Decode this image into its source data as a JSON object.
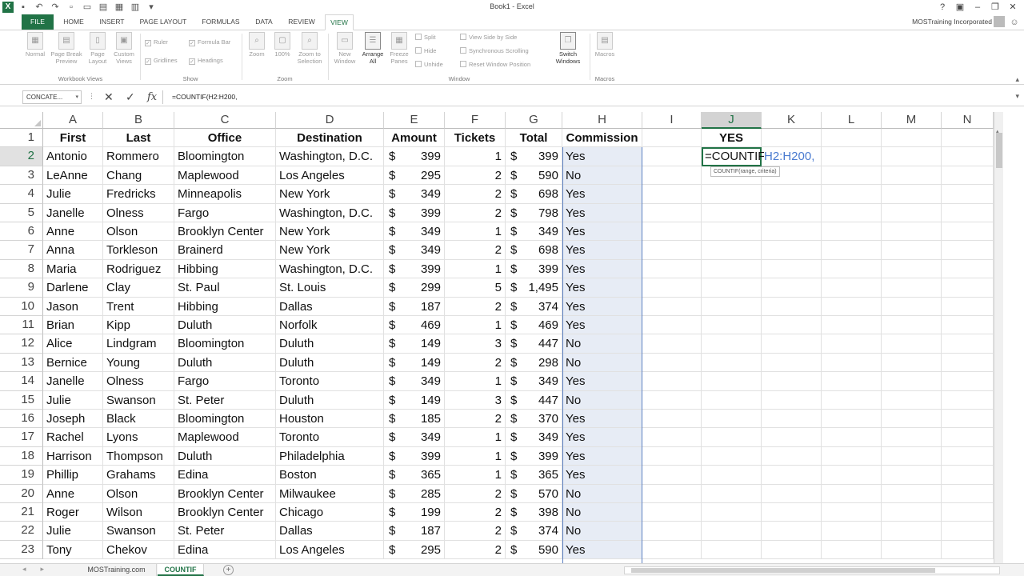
{
  "window": {
    "title": "Book1 - Excel",
    "account": "MOSTraining Incorporated",
    "logo": "X"
  },
  "tabs": [
    "FILE",
    "HOME",
    "INSERT",
    "PAGE LAYOUT",
    "FORMULAS",
    "DATA",
    "REVIEW",
    "VIEW"
  ],
  "active_tab": "VIEW",
  "ribbon": {
    "workbook_views": {
      "label": "Workbook Views",
      "buttons": [
        "Normal",
        "Page Break Preview",
        "Page Layout",
        "Custom Views"
      ]
    },
    "show": {
      "label": "Show",
      "checks": [
        "Ruler",
        "Formula Bar",
        "Gridlines",
        "Headings"
      ]
    },
    "zoom": {
      "label": "Zoom",
      "buttons": [
        "Zoom",
        "100%",
        "Zoom to Selection"
      ]
    },
    "window": {
      "label": "Window",
      "buttons": [
        "New Window",
        "Arrange All",
        "Freeze Panes"
      ],
      "small": [
        "Split",
        "Hide",
        "Unhide"
      ],
      "side": [
        "View Side by Side",
        "Synchronous Scrolling",
        "Reset Window Position"
      ],
      "switch": "Switch Windows"
    },
    "macros": {
      "label": "Macros",
      "button": "Macros"
    }
  },
  "formula_bar": {
    "name_box": "CONCATE...",
    "formula": "=COUNTIF(H2:H200,"
  },
  "columns": [
    "A",
    "B",
    "C",
    "D",
    "E",
    "F",
    "G",
    "H",
    "I",
    "J",
    "K",
    "L",
    "M",
    "N"
  ],
  "selected_column": "J",
  "headers": [
    "First",
    "Last",
    "Office",
    "Destination",
    "Amount",
    "Tickets",
    "Total",
    "Commission"
  ],
  "j1": "YES",
  "edit": {
    "fn": "=COUNTIF(",
    "ref": "H2:H200,",
    "tooltip": "COUNTIF(range, criteria)"
  },
  "currency": "$",
  "rows": [
    [
      "Antonio",
      "Rommero",
      "Bloomington",
      "Washington, D.C.",
      "399",
      "1",
      "399",
      "Yes"
    ],
    [
      "LeAnne",
      "Chang",
      "Maplewood",
      "Los Angeles",
      "295",
      "2",
      "590",
      "No"
    ],
    [
      "Julie",
      "Fredricks",
      "Minneapolis",
      "New York",
      "349",
      "2",
      "698",
      "Yes"
    ],
    [
      "Janelle",
      "Olness",
      "Fargo",
      "Washington, D.C.",
      "399",
      "2",
      "798",
      "Yes"
    ],
    [
      "Anne",
      "Olson",
      "Brooklyn Center",
      "New York",
      "349",
      "1",
      "349",
      "Yes"
    ],
    [
      "Anna",
      "Torkleson",
      "Brainerd",
      "New York",
      "349",
      "2",
      "698",
      "Yes"
    ],
    [
      "Maria",
      "Rodriguez",
      "Hibbing",
      "Washington, D.C.",
      "399",
      "1",
      "399",
      "Yes"
    ],
    [
      "Darlene",
      "Clay",
      "St. Paul",
      "St. Louis",
      "299",
      "5",
      "1,495",
      "Yes"
    ],
    [
      "Jason",
      "Trent",
      "Hibbing",
      "Dallas",
      "187",
      "2",
      "374",
      "Yes"
    ],
    [
      "Brian",
      "Kipp",
      "Duluth",
      "Norfolk",
      "469",
      "1",
      "469",
      "Yes"
    ],
    [
      "Alice",
      "Lindgram",
      "Bloomington",
      "Duluth",
      "149",
      "3",
      "447",
      "No"
    ],
    [
      "Bernice",
      "Young",
      "Duluth",
      "Duluth",
      "149",
      "2",
      "298",
      "No"
    ],
    [
      "Janelle",
      "Olness",
      "Fargo",
      "Toronto",
      "349",
      "1",
      "349",
      "Yes"
    ],
    [
      "Julie",
      "Swanson",
      "St. Peter",
      "Duluth",
      "149",
      "3",
      "447",
      "No"
    ],
    [
      "Joseph",
      "Black",
      "Bloomington",
      "Houston",
      "185",
      "2",
      "370",
      "Yes"
    ],
    [
      "Rachel",
      "Lyons",
      "Maplewood",
      "Toronto",
      "349",
      "1",
      "349",
      "Yes"
    ],
    [
      "Harrison",
      "Thompson",
      "Duluth",
      "Philadelphia",
      "399",
      "1",
      "399",
      "Yes"
    ],
    [
      "Phillip",
      "Grahams",
      "Edina",
      "Boston",
      "365",
      "1",
      "365",
      "Yes"
    ],
    [
      "Anne",
      "Olson",
      "Brooklyn Center",
      "Milwaukee",
      "285",
      "2",
      "570",
      "No"
    ],
    [
      "Roger",
      "Wilson",
      "Brooklyn Center",
      "Chicago",
      "199",
      "2",
      "398",
      "No"
    ],
    [
      "Julie",
      "Swanson",
      "St. Peter",
      "Dallas",
      "187",
      "2",
      "374",
      "No"
    ],
    [
      "Tony",
      "Chekov",
      "Edina",
      "Los Angeles",
      "295",
      "2",
      "590",
      "Yes"
    ]
  ],
  "sheets": [
    "MOSTraining.com",
    "COUNTIF"
  ],
  "active_sheet": "COUNTIF",
  "colors": {
    "excel_green": "#217346",
    "selection_blue": "#5b7fc1",
    "reference_blue": "#4a7bd0"
  }
}
